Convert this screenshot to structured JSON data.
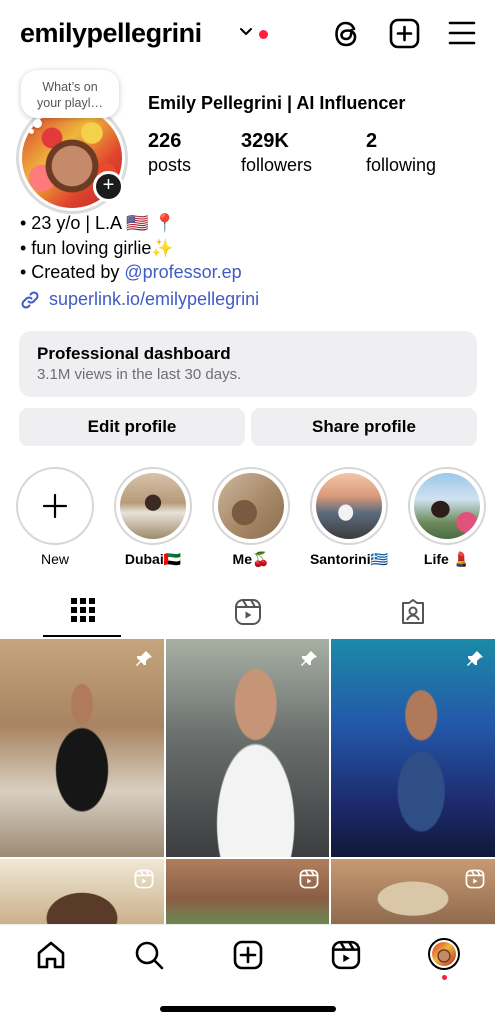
{
  "header": {
    "username": "emilypellegrini",
    "icons": [
      "chevron-down-icon",
      "threads-icon",
      "new-post-icon",
      "menu-icon"
    ],
    "notification_color": "#ff1f3d"
  },
  "profile": {
    "note_line1": "What’s on",
    "note_line2": "your playl…",
    "full_name": "Emily Pellegrini | AI Influencer",
    "stats": [
      {
        "value": "226",
        "label": "posts"
      },
      {
        "value": "329K",
        "label": "followers"
      },
      {
        "value": "2",
        "label": "following"
      }
    ],
    "bio": {
      "line1": "• 23 y/o | L.A 🇺🇸 📍",
      "line2": "• fun loving girlie✨",
      "line3_prefix": "• Created by ",
      "line3_mention": "@professor.ep"
    },
    "link": "superlink.io/emilypellegrini"
  },
  "dashboard": {
    "title": "Professional dashboard",
    "subtitle": "3.1M views in the last 30 days."
  },
  "buttons": {
    "edit": "Edit profile",
    "share": "Share profile"
  },
  "highlights": [
    {
      "label": "New"
    },
    {
      "label": "Dubai🇦🇪"
    },
    {
      "label": "Me🍒"
    },
    {
      "label": "Santorini🇬🇷"
    },
    {
      "label": "Life 💄"
    }
  ],
  "tabs": [
    "grid-icon",
    "reels-icon",
    "tagged-icon"
  ],
  "posts": [
    {
      "kind": "pinned"
    },
    {
      "kind": "pinned"
    },
    {
      "kind": "pinned"
    },
    {
      "kind": "reel"
    },
    {
      "kind": "reel"
    },
    {
      "kind": "reel"
    }
  ],
  "bottom_nav": [
    "home-icon",
    "search-icon",
    "create-icon",
    "reels-icon",
    "profile-avatar"
  ],
  "colors": {
    "link": "#3f5bc6",
    "button_bg": "#efeff1",
    "accent_red": "#ff1f3d"
  }
}
